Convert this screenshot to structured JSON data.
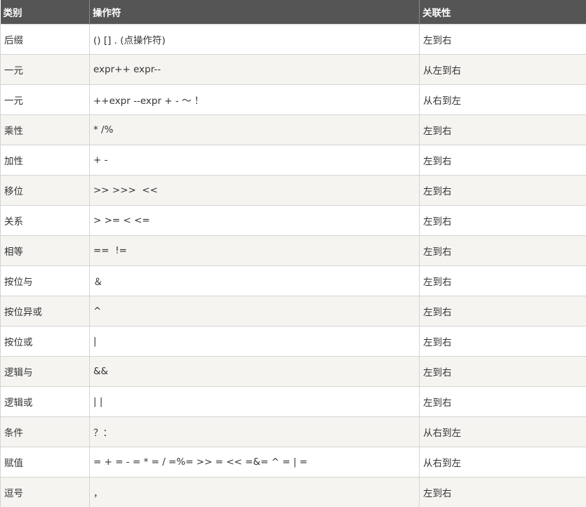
{
  "table": {
    "headers": [
      "类别",
      "操作符",
      "关联性"
    ],
    "rows": [
      {
        "category": "后缀",
        "operators": "() [] . (点操作符)",
        "associativity": "左到右"
      },
      {
        "category": "一元",
        "operators": "expr++ expr--",
        "associativity": "从左到右"
      },
      {
        "category": "一元",
        "operators": "++expr --expr + - ～ ！",
        "associativity": "从右到左"
      },
      {
        "category": "乘性",
        "operators": "* /%",
        "associativity": "左到右"
      },
      {
        "category": "加性",
        "operators": "+ -",
        "associativity": "左到右"
      },
      {
        "category": "移位",
        "operators": ">> >>>  <<",
        "associativity": "左到右"
      },
      {
        "category": "关系",
        "operators": "> >= < <=",
        "associativity": "左到右"
      },
      {
        "category": "相等",
        "operators": "==  !=",
        "associativity": "左到右"
      },
      {
        "category": "按位与",
        "operators": "＆",
        "associativity": "左到右"
      },
      {
        "category": "按位异或",
        "operators": "^",
        "associativity": "左到右"
      },
      {
        "category": "按位或",
        "operators": "|",
        "associativity": "左到右"
      },
      {
        "category": "逻辑与",
        "operators": "&&",
        "associativity": "左到右"
      },
      {
        "category": "逻辑或",
        "operators": "| |",
        "associativity": "左到右"
      },
      {
        "category": "条件",
        "operators": "？：",
        "associativity": "从右到左"
      },
      {
        "category": "赋值",
        "operators": "= + = - = * = / =%= >> = << =&= ^ = | =",
        "associativity": "从右到左"
      },
      {
        "category": "逗号",
        "operators": "，",
        "associativity": "左到右"
      }
    ]
  },
  "colors": {
    "header_bg": "#555555",
    "header_text": "#ffffff",
    "row_alt_bg": "#f5f4f0",
    "border": "#d4d4d4",
    "text": "#333333"
  }
}
